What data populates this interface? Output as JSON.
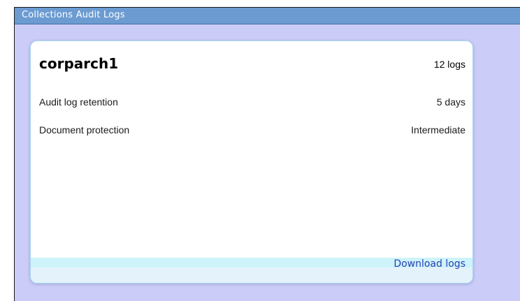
{
  "window": {
    "title": "Collections Audit Logs"
  },
  "card": {
    "collection_name": "corparch1",
    "log_count": "12 logs",
    "properties": [
      {
        "label": "Audit log retention",
        "value": "5 days"
      },
      {
        "label": "Document protection",
        "value": "Intermediate"
      }
    ],
    "download_label": "Download logs"
  },
  "colors": {
    "panel_background": "#ccccf8",
    "titlebar": "#6b9bd1",
    "card_border": "#a9d7f2",
    "footer_band": "#ccf4fa",
    "link": "#2c3db5"
  }
}
